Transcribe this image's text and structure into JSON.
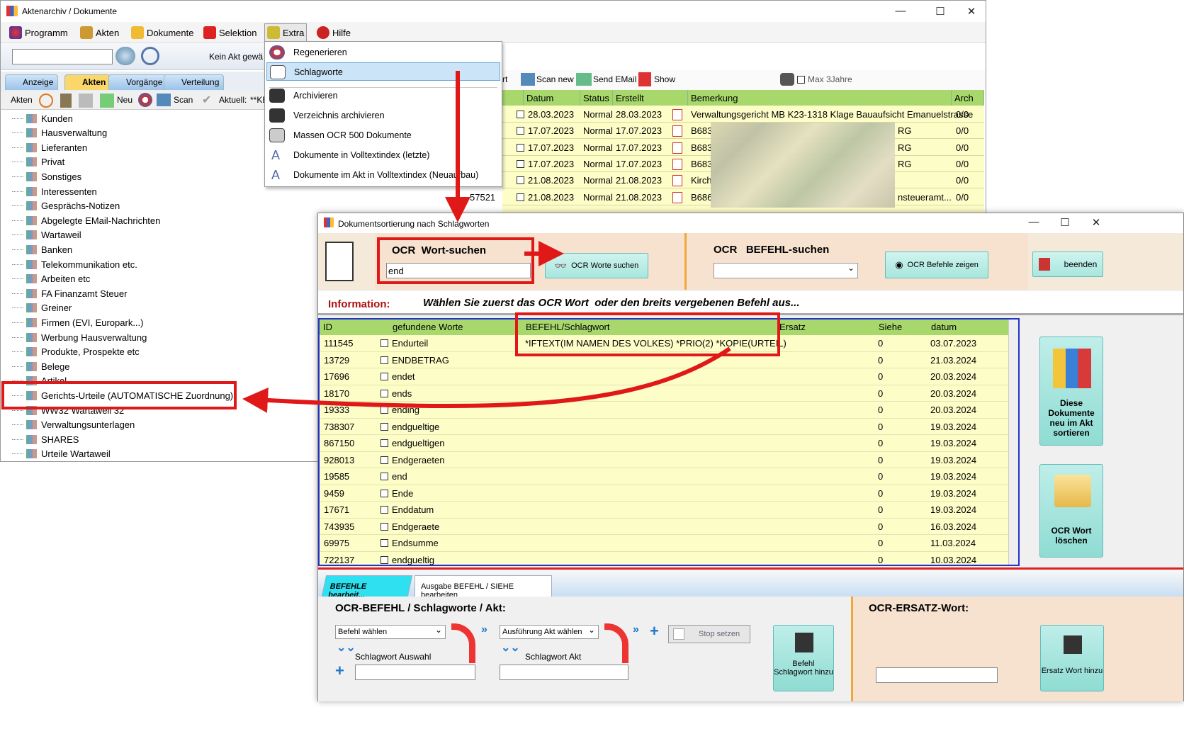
{
  "main": {
    "title": "Aktenarchiv / Dokumente",
    "menu": [
      "Programm",
      "Akten",
      "Dokumente",
      "Selektion",
      "Extra",
      "Hilfe"
    ],
    "status_text": "Kein Akt gewä",
    "tabs": [
      "Anzeige",
      "Akten",
      "Vorgänge",
      "Verteilung"
    ],
    "toolbar2": {
      "akten": "Akten",
      "neu": "Neu",
      "scan": "Scan",
      "aktuell": "Aktuell:",
      "ke": "**KE"
    },
    "tree": [
      "Kunden",
      "Hausverwaltung",
      "Lieferanten",
      "Privat",
      "Sonstiges",
      "Interessenten",
      "Gesprächs-Notizen",
      "Abgelegte EMail-Nachrichten",
      "Wartaweil",
      "Banken",
      "Telekommunikation etc.",
      "Arbeiten etc",
      "FA Finanzamt Steuer",
      "Greiner",
      "Firmen (EVI, Europark...)",
      "Werbung Hausverwaltung",
      "Produkte, Prospekte etc",
      "Belege",
      "Artikel",
      "Gerichts-Urteile (AUTOMATISCHE Zuordnung)",
      "WW32 Wartaweil 32",
      "Verwaltungsunterlagen",
      "SHARES",
      "Urteile Wartaweil"
    ],
    "right_toolbar": {
      "rt": "rt",
      "scan_new": "Scan new",
      "send_email": "Send EMail",
      "show": "Show",
      "max3": "Max 3Jahre"
    },
    "grid_headers": [
      "Datum",
      "Status",
      "Erstellt",
      "Bemerkung",
      "Arch"
    ],
    "grid_rows": [
      {
        "id": "",
        "datum": "28.03.2023",
        "status": "Normal",
        "erstellt": "28.03.2023",
        "bem": "Verwaltungsgericht MB K23-1318 Klage Bauaufsicht Emanuelstrasse",
        "arch": "0/0"
      },
      {
        "id": "",
        "datum": "17.07.2023",
        "status": "Normal",
        "erstellt": "17.07.2023",
        "bem": "B683",
        "bem2": "RG",
        "arch": "0/0"
      },
      {
        "id": "",
        "datum": "17.07.2023",
        "status": "Normal",
        "erstellt": "17.07.2023",
        "bem": "B683",
        "bem2": "RG",
        "arch": "0/0"
      },
      {
        "id": "",
        "datum": "17.07.2023",
        "status": "Normal",
        "erstellt": "17.07.2023",
        "bem": "B683",
        "bem2": "RG",
        "arch": "0/0"
      },
      {
        "id": "",
        "datum": "21.08.2023",
        "status": "Normal",
        "erstellt": "21.08.2023",
        "bem": "Kirch",
        "bem2": "",
        "arch": "0/0"
      },
      {
        "id": "57521",
        "datum": "21.08.2023",
        "status": "Normal",
        "erstellt": "21.08.2023",
        "bem": "B686",
        "bem2": "nsteueramt...",
        "arch": "0/0"
      }
    ]
  },
  "dropdown": [
    "Regenerieren",
    "Schlagworte",
    "Archivieren",
    "Verzeichnis archivieren",
    "Massen OCR 500 Dokumente",
    "Dokumente in Volltextindex (letzte)",
    "Dokumente im Akt in Volltextindex (Neuaufbau)"
  ],
  "dialog": {
    "title": "Dokumentsortierung nach Schlagworten",
    "ocr_label": "OCR  Wort-suchen",
    "search_value": "end",
    "ocr_worte_btn": "OCR Worte suchen",
    "befehl_label": "OCR   BEFEHL-suchen",
    "befehle_btn": "OCR Befehle zeigen",
    "beenden": "beenden",
    "info_label": "Information:",
    "info_text": "Wählen Sie zuerst das OCR Wort  oder den breits vergebenen Befehl aus...",
    "headers": [
      "ID",
      "gefundene Worte",
      "BEFEHL/Schlagwort",
      "Ersatz",
      "Siehe",
      "datum"
    ],
    "rows": [
      {
        "id": "111545",
        "wort": "Endurteil",
        "befehl": "*IFTEXT(IM NAMEN DES VOLKES) *PRIO(2) *KOPIE(URTEIL)",
        "siehe": "0",
        "datum": "03.07.2023"
      },
      {
        "id": "13729",
        "wort": "ENDBETRAG",
        "befehl": "",
        "siehe": "0",
        "datum": "21.03.2024"
      },
      {
        "id": "17696",
        "wort": "endet",
        "befehl": "",
        "siehe": "0",
        "datum": "20.03.2024"
      },
      {
        "id": "18170",
        "wort": "ends",
        "befehl": "",
        "siehe": "0",
        "datum": "20.03.2024"
      },
      {
        "id": "19333",
        "wort": "ending",
        "befehl": "",
        "siehe": "0",
        "datum": "20.03.2024"
      },
      {
        "id": "738307",
        "wort": "endgueltige",
        "befehl": "",
        "siehe": "0",
        "datum": "19.03.2024"
      },
      {
        "id": "867150",
        "wort": "endgueltigen",
        "befehl": "",
        "siehe": "0",
        "datum": "19.03.2024"
      },
      {
        "id": "928013",
        "wort": "Endgeraeten",
        "befehl": "",
        "siehe": "0",
        "datum": "19.03.2024"
      },
      {
        "id": "19585",
        "wort": "end",
        "befehl": "",
        "siehe": "0",
        "datum": "19.03.2024"
      },
      {
        "id": "9459",
        "wort": "Ende",
        "befehl": "",
        "siehe": "0",
        "datum": "19.03.2024"
      },
      {
        "id": "17671",
        "wort": "Enddatum",
        "befehl": "",
        "siehe": "0",
        "datum": "19.03.2024"
      },
      {
        "id": "743935",
        "wort": "Endgeraete",
        "befehl": "",
        "siehe": "0",
        "datum": "16.03.2024"
      },
      {
        "id": "69975",
        "wort": "Endsumme",
        "befehl": "",
        "siehe": "0",
        "datum": "11.03.2024"
      },
      {
        "id": "722137",
        "wort": "endgueltig",
        "befehl": "",
        "siehe": "0",
        "datum": "10.03.2024"
      }
    ],
    "side_btn1": "Diese Dokumente neu im Akt sortieren",
    "side_btn2": "OCR Wort löschen",
    "tab1": "BEFEHLE bearbeit...",
    "tab2": "Ausgabe BEFEHL  / SIEHE bearbeiten",
    "bottom_title": "OCR-BEFEHL / Schlagworte / Akt:",
    "befehl_waehlen": "Befehl wählen",
    "ausfuehrung": "Ausführung Akt wählen",
    "stop_setzen": "Stop setzen",
    "schlag_auswahl": "Schlagwort Auswahl",
    "schlag_akt": "Schlagwort Akt",
    "befehl_hinzu": "Befehl Schlagwort hinzu",
    "ersatz_title": "OCR-ERSATZ-Wort:",
    "ersatz_hinzu": "Ersatz Wort hinzu"
  },
  "colors": {
    "grid_header": "#a8d86c",
    "grid_bg": "#fdfdc8",
    "annotation": "#e01818",
    "accent_orange": "#f2a73a"
  }
}
